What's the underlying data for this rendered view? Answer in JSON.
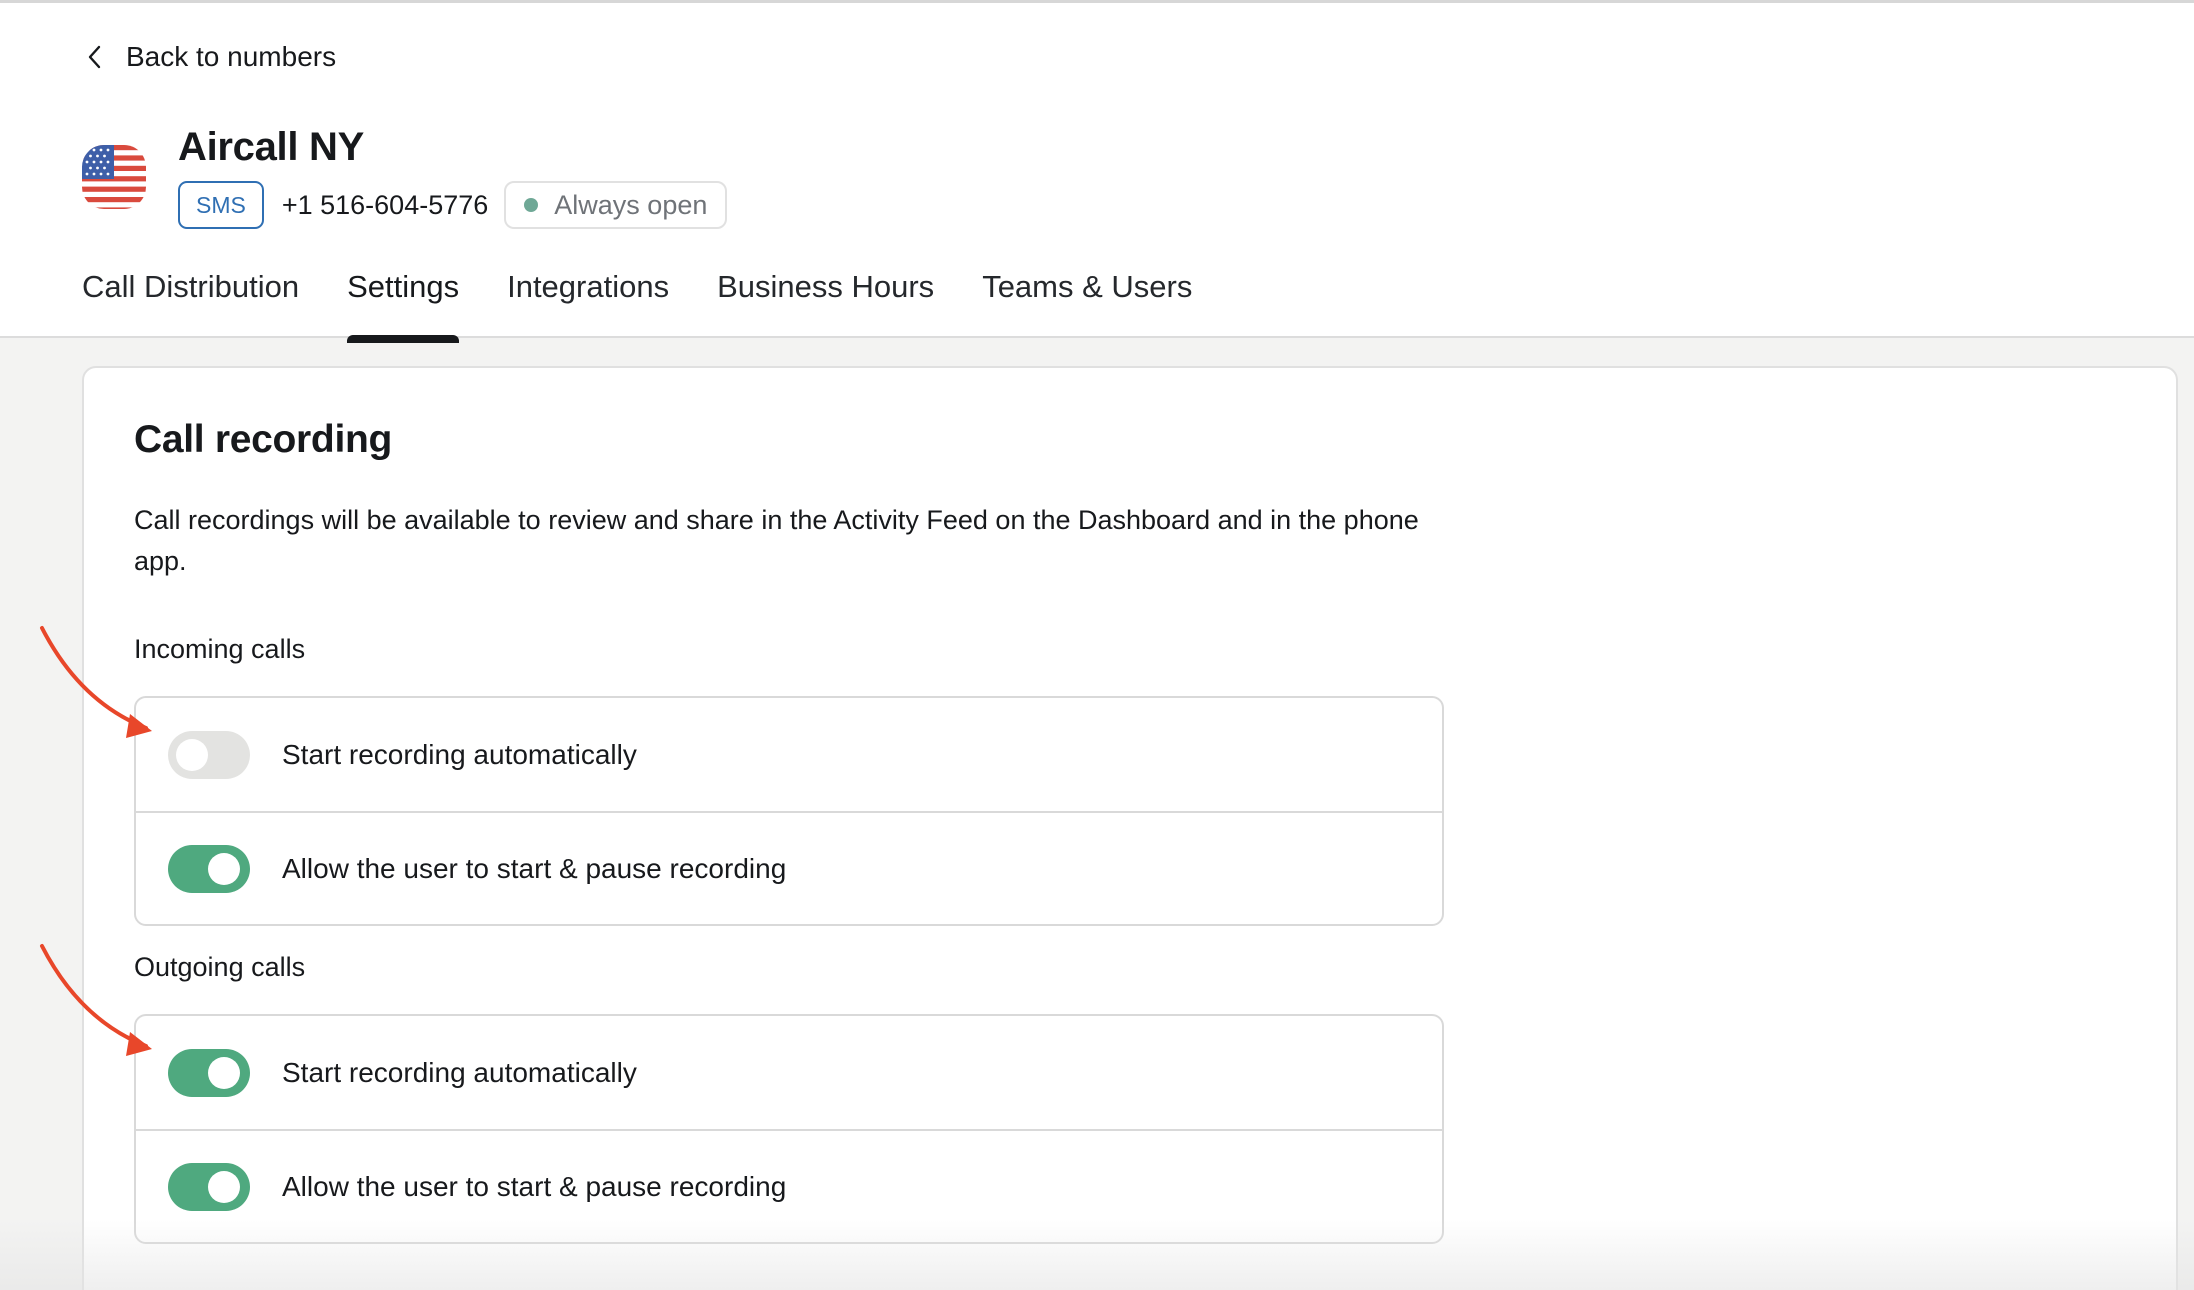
{
  "header": {
    "back_label": "Back to numbers",
    "title": "Aircall NY",
    "badge": "SMS",
    "phone": "+1 516-604-5776",
    "status": "Always open",
    "status_color": "#6fa896",
    "flag_icon": "us-flag-icon"
  },
  "tabs": [
    {
      "label": "Call Distribution",
      "active": false
    },
    {
      "label": "Settings",
      "active": true
    },
    {
      "label": "Integrations",
      "active": false
    },
    {
      "label": "Business Hours",
      "active": false
    },
    {
      "label": "Teams & Users",
      "active": false
    }
  ],
  "call_recording": {
    "title": "Call recording",
    "description": "Call recordings will be available to review and share in the Activity Feed on the Dashboard and in the phone app.",
    "incoming": {
      "label": "Incoming calls",
      "options": [
        {
          "label": "Start recording automatically",
          "enabled": false
        },
        {
          "label": "Allow the user to start & pause recording",
          "enabled": true
        }
      ]
    },
    "outgoing": {
      "label": "Outgoing calls",
      "options": [
        {
          "label": "Start recording automatically",
          "enabled": true
        },
        {
          "label": "Allow the user to start & pause recording",
          "enabled": true
        }
      ]
    }
  },
  "colors": {
    "toggle_on": "#4fa97f",
    "toggle_off": "#e3e3e1",
    "badge_blue": "#2f6fb3",
    "annotation_red": "#e8472a"
  }
}
